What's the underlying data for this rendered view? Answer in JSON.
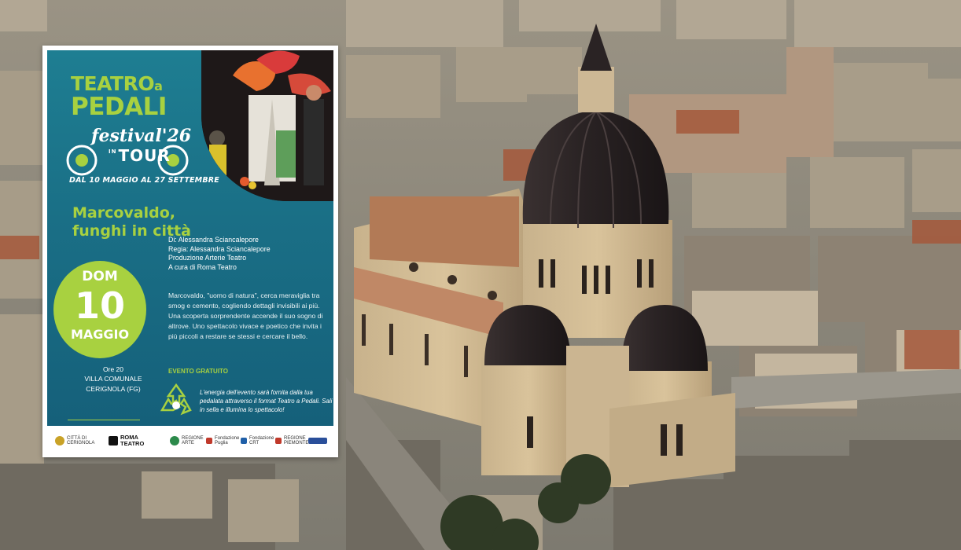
{
  "poster": {
    "title_line1": "TEATRO",
    "title_a": "a",
    "title_line2": "PEDALI",
    "festival": "festival'26",
    "intour_in": "IN",
    "intour": "TOUR",
    "dates": "DAL 10 MAGGIO AL 27 SETTEMBRE",
    "show_title_1": "Marcovaldo,",
    "show_title_2": "funghi in città",
    "badge": {
      "dow": "DOM",
      "day": "10",
      "month": "MAGGIO"
    },
    "time": "Ore 20",
    "venue": "VILLA COMUNALE",
    "city": "CERIGNOLA (FG)",
    "credits": [
      "Di: Alessandra Sciancalepore",
      "Regia: Alessandra Sciancalepore",
      "Produzione Arterie Teatro",
      "A cura di Roma Teatro"
    ],
    "synopsis": "Marcovaldo, \"uomo di natura\", cerca meraviglia tra smog e cemento, cogliendo dettagli invisibili ai più. Una scoperta sorprendente accende il suo sogno di altrove. Uno spettacolo vivace e poetico che invita i più piccoli a restare se stessi e cercare il bello.",
    "free_event": "EVENTO GRATUITO",
    "energy_note": "L'energia dell'evento sarà fornita dalla tua pedalata attraverso il format Teatro a Pedali. Sali in sella e illumina lo spettacolo!",
    "footer_logos": [
      {
        "name": "CITTÀ DI",
        "sub": "CERIGNOLA",
        "color": "#c9a227"
      },
      {
        "name": "ROMA",
        "sub": "TEATRO",
        "color": "#111111"
      },
      {
        "name": "REGIONE",
        "sub": "ARTE",
        "color": "#2c8a4b"
      },
      {
        "name": "Fondazione",
        "sub": "Puglia",
        "color": "#c0392b"
      },
      {
        "name": "Fondazione",
        "sub": "CRT",
        "color": "#1f5fa8"
      },
      {
        "name": "REGIONE",
        "sub": "PIEMONTE",
        "color": "#c0392b"
      },
      {
        "name": "",
        "sub": "",
        "color": "#2a4f9a"
      }
    ]
  },
  "colors": {
    "accent_green": "#a8d140",
    "poster_teal": "#1a6f86"
  }
}
